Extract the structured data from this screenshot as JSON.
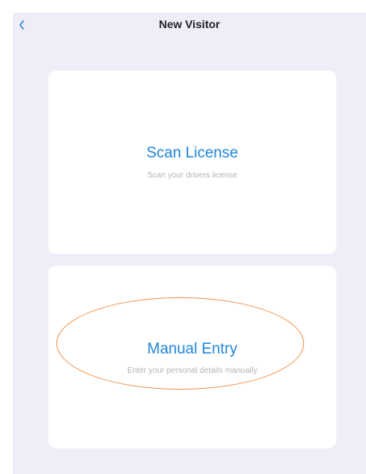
{
  "header": {
    "title": "New Visitor",
    "back_icon": "chevron-left-icon"
  },
  "options": {
    "scan": {
      "title": "Scan License",
      "subtitle": "Scan your drivers license"
    },
    "manual": {
      "title": "Manual Entry",
      "subtitle": "Enter your personal details manually"
    }
  },
  "colors": {
    "background": "#efeef8",
    "card": "#ffffff",
    "accent": "#1f86da",
    "subtitle": "#b4b4bc",
    "annotation": "#f2924a"
  }
}
